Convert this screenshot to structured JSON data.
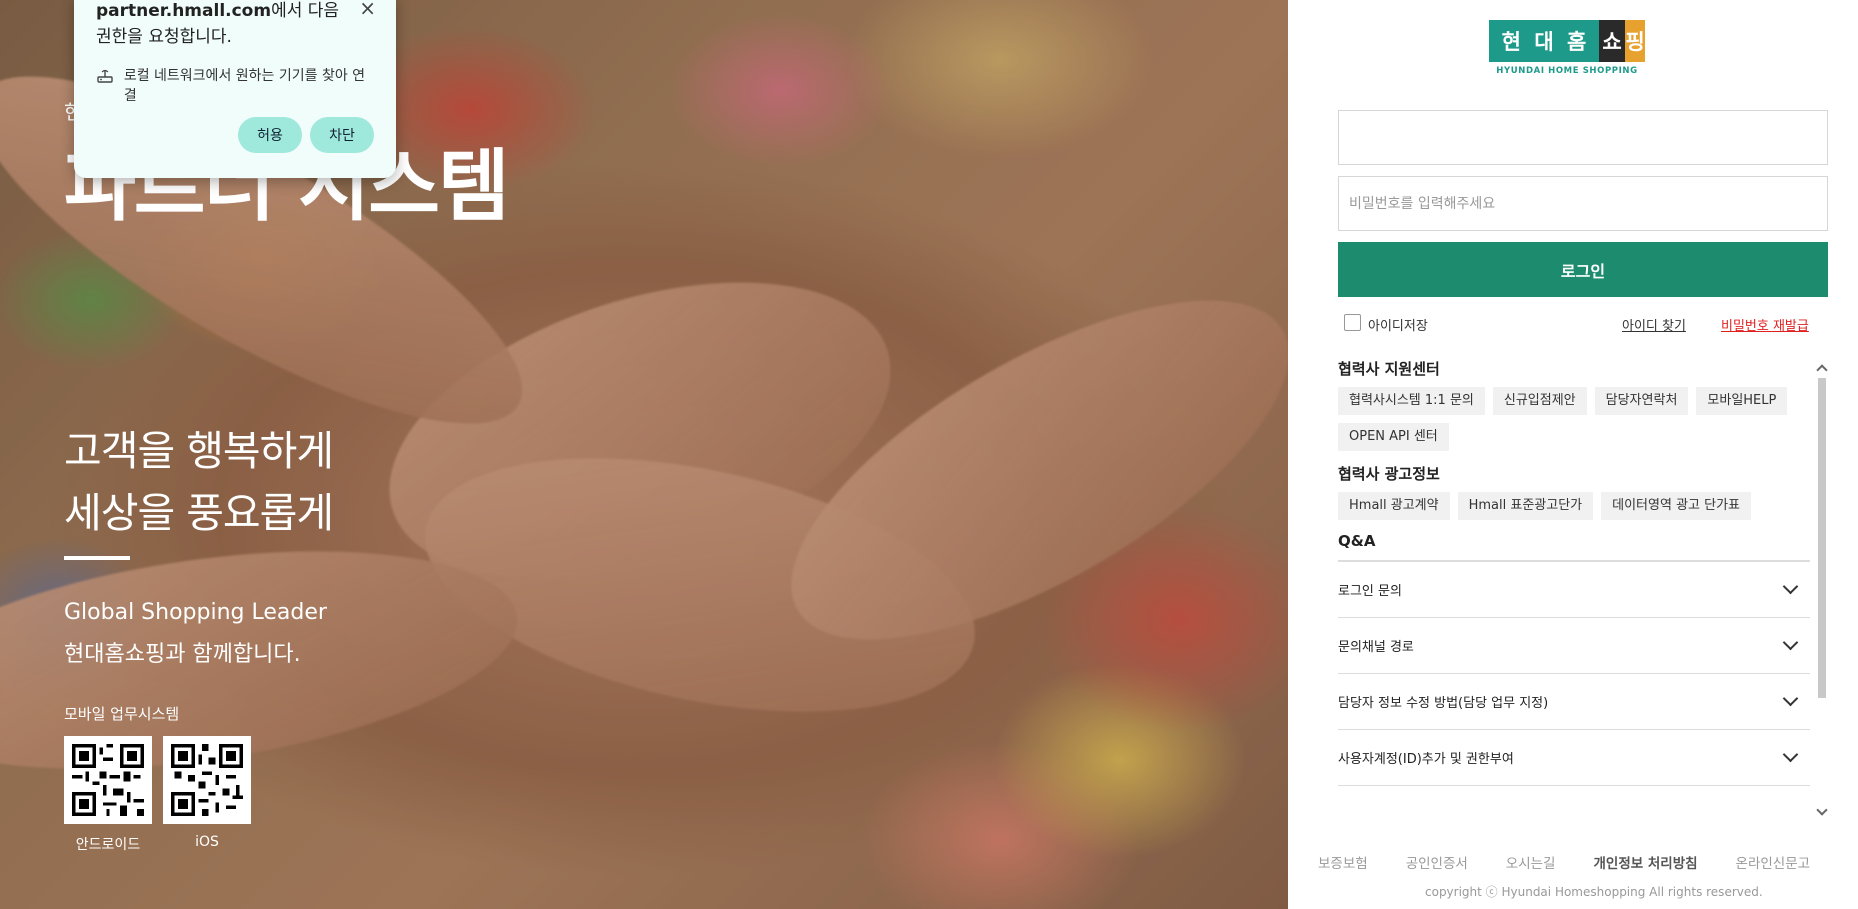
{
  "popup": {
    "title_domain": "partner.hmall.com",
    "title_rest": "에서 다음 권한을 요청합니다.",
    "close": "×",
    "permission": "로컬 네트워크에서 원하는 기기를 찾아 연결",
    "allow": "허용",
    "block": "차단"
  },
  "hero": {
    "small_title": "현",
    "title": "파트너 시스템",
    "slogan_line1": "고객을 행복하게",
    "slogan_line2": "세상을 풍요롭게",
    "global_line1": "Global Shopping Leader",
    "global_line2": "현대홈쇼핑과 함께합니다.",
    "mobile_title": "모바일 업무시스템",
    "qr_android": "안드로이드",
    "qr_ios": "iOS"
  },
  "logo": {
    "chars": [
      "현",
      "대",
      "홈",
      "쇼",
      "핑"
    ],
    "sub": "HYUNDAI HOME SHOPPING",
    "colors": {
      "green": "#1e9a8a",
      "orange": "#e6a12e"
    }
  },
  "login": {
    "id_value": "",
    "pw_placeholder": "비밀번호를 입력해주세요",
    "button": "로그인",
    "save_id": "아이디저장",
    "find_id": "아이디 찾기",
    "reset_pw": "비밀번호 재발급",
    "accent": "#1d8c6e"
  },
  "support": {
    "title": "협력사 지원센터",
    "tags": [
      "협력사시스템 1:1 문의",
      "신규입점제안",
      "담당자연락처",
      "모바일HELP",
      "OPEN API 센터"
    ]
  },
  "ads": {
    "title": "협력사 광고정보",
    "tags": [
      "Hmall 광고계약",
      "Hmall 표준광고단가",
      "데이터영역 광고 단가표"
    ]
  },
  "qa": {
    "title": "Q&A",
    "items": [
      "로그인 문의",
      "문의채널 경로",
      "담당자 정보 수정 방법(담당 업무 지정)",
      "사용자계정(ID)추가 및 권한부여"
    ]
  },
  "footer": {
    "links": [
      "보증보험",
      "공인인증서",
      "오시는길",
      "개인정보 처리방침",
      "온라인신문고"
    ],
    "copyright": "copyright ⓒ Hyundai Homeshopping All rights reserved."
  }
}
